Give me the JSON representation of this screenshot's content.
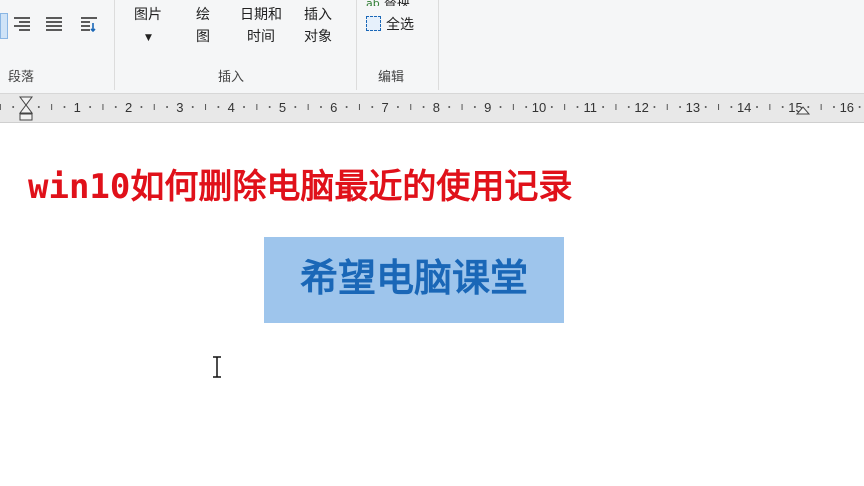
{
  "ribbon": {
    "groups": {
      "paragraph": "段落",
      "insert": "插入",
      "edit": "编辑"
    },
    "insert": {
      "picture_label": "图片",
      "drawing_line1": "绘",
      "drawing_line2": "图",
      "datetime_line1": "日期和",
      "datetime_line2": "时间",
      "object_line1": "插入",
      "object_line2": "对象"
    },
    "edit": {
      "replace_label": "替换",
      "select_all_label": "全选"
    }
  },
  "ruler": {
    "numbers": [
      "1",
      "1",
      "2",
      "3",
      "4",
      "5",
      "6",
      "7",
      "8",
      "9",
      "10",
      "11",
      "12",
      "13",
      "14",
      "15",
      "16"
    ]
  },
  "document": {
    "title": "win10如何删除电脑最近的使用记录",
    "subtitle": "希望电脑课堂"
  },
  "colors": {
    "title": "#e0111a",
    "subtitle": "#1a67b7",
    "selection": "#9ec5ec"
  }
}
